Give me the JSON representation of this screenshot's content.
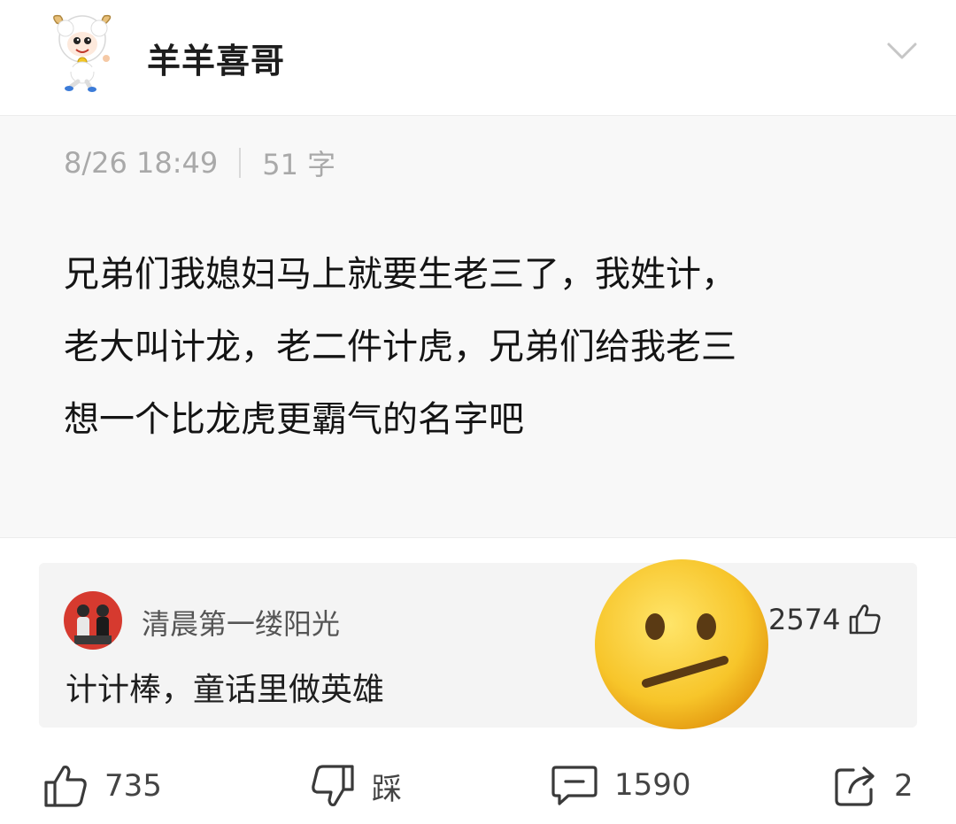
{
  "header": {
    "author_name": "羊羊喜哥",
    "avatar_icon": "pleasant-goat-avatar-icon",
    "collapse_icon": "chevron-down-icon"
  },
  "post": {
    "date": "8/26 18:49",
    "word_count": "51 字",
    "lines": [
      "兄弟们我媳妇马上就要生老三了，我姓计，",
      "老大叫计龙，老二件计虎，兄弟们给我老三",
      "想一个比龙虎更霸气的名字吧"
    ]
  },
  "top_comment": {
    "user": "清晨第一缕阳光",
    "likes": "2574",
    "text": "计计棒，童话里做英雄",
    "like_icon": "thumbs-up-outline-icon"
  },
  "overlay": {
    "emoji_icon": "neutral-face-emoji-icon"
  },
  "actions": {
    "like": {
      "count": "735",
      "icon": "thumbs-up-icon"
    },
    "dislike": {
      "label": "踩",
      "icon": "thumbs-down-icon"
    },
    "comment": {
      "count": "1590",
      "icon": "comment-icon"
    },
    "share": {
      "count": "2",
      "icon": "share-icon"
    }
  },
  "colors": {
    "post_background": "#f8f8f8",
    "comment_background": "#f4f4f4",
    "meta_text": "#a9a9a9",
    "emoji_yellow": "#f6c226"
  }
}
